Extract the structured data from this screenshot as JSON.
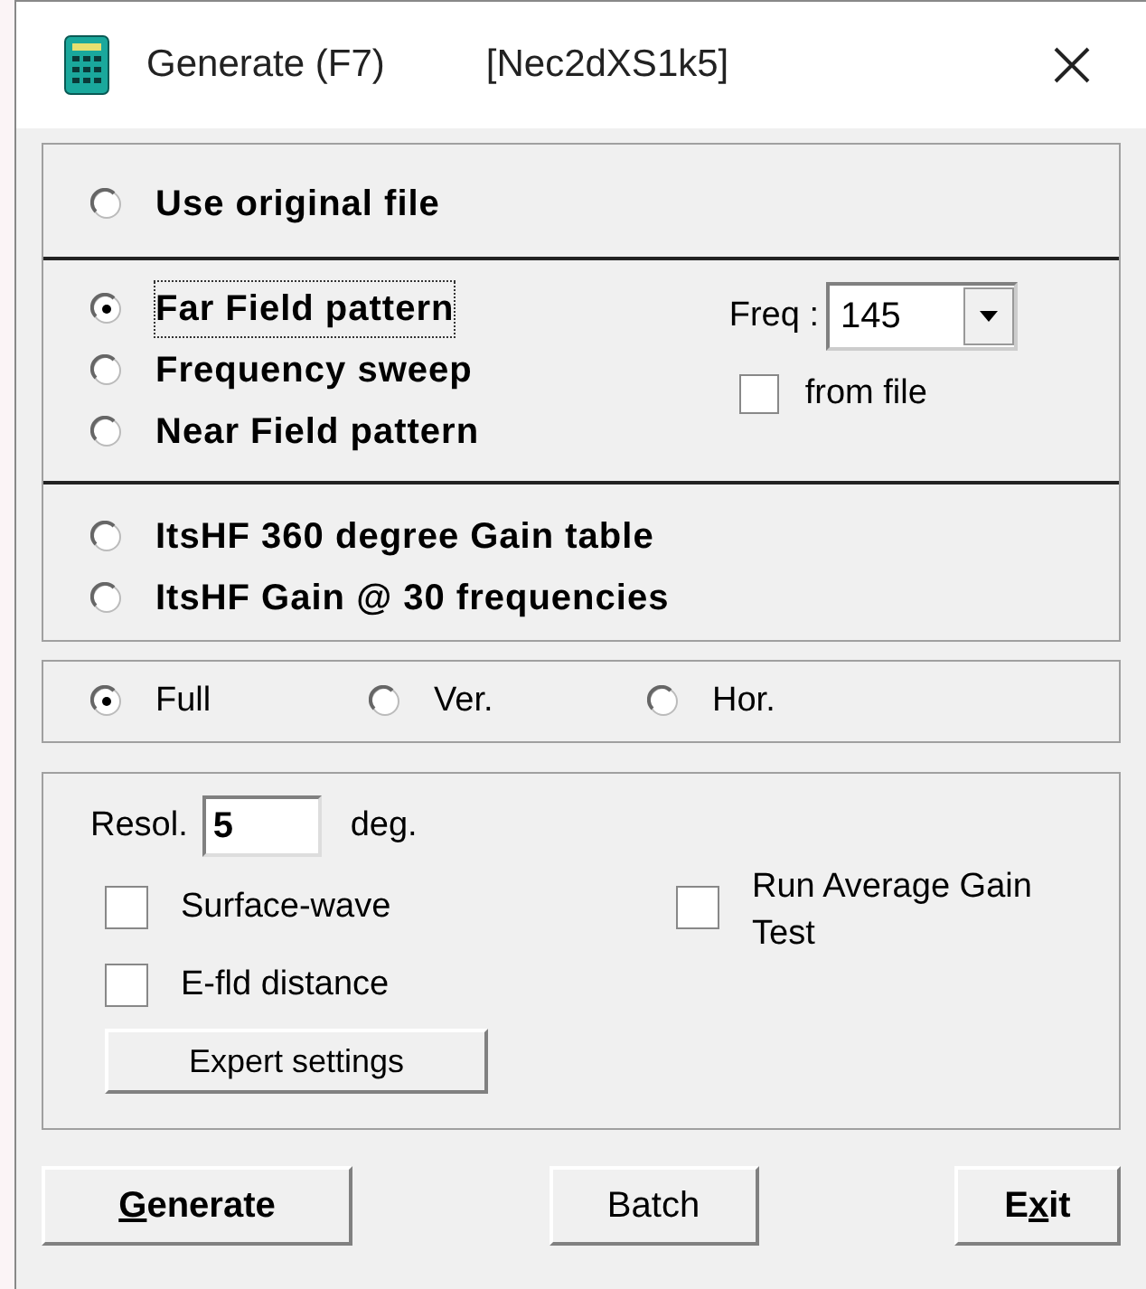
{
  "window": {
    "title": "Generate (F7)",
    "subtitle": "[Nec2dXS1k5]"
  },
  "source_groups": [
    {
      "options": [
        {
          "label": "Use original file",
          "selected": false,
          "focused": false
        }
      ]
    },
    {
      "options": [
        {
          "label": "Far Field pattern",
          "selected": true,
          "focused": true
        },
        {
          "label": "Frequency sweep",
          "selected": false,
          "focused": false
        },
        {
          "label": "Near Field pattern",
          "selected": false,
          "focused": false
        }
      ]
    },
    {
      "options": [
        {
          "label": "ItsHF 360 degree Gain table",
          "selected": false,
          "focused": false
        },
        {
          "label": "ItsHF Gain @ 30 frequencies",
          "selected": false,
          "focused": false
        }
      ]
    }
  ],
  "freq": {
    "label": "Freq :",
    "value": "145",
    "from_file": {
      "label": "from file",
      "checked": false
    }
  },
  "pattern": [
    {
      "label": "Full",
      "selected": true
    },
    {
      "label": "Ver.",
      "selected": false
    },
    {
      "label": "Hor.",
      "selected": false
    }
  ],
  "resolution": {
    "label": "Resol.",
    "value": "5",
    "unit": "deg."
  },
  "options": [
    {
      "label": "Surface-wave",
      "checked": false
    },
    {
      "label": "E-fld distance",
      "checked": false
    }
  ],
  "average_test": {
    "label": "Run Average Gain Test",
    "checked": false
  },
  "expert_button": "Expert settings",
  "buttons": [
    {
      "label": [
        {
          "text": "G",
          "underlined": true
        },
        {
          "text": "enerate",
          "underlined": false
        }
      ],
      "bold": true
    },
    {
      "label": [
        {
          "text": "Batch",
          "underlined": false
        }
      ],
      "bold": false
    },
    {
      "label": [
        {
          "text": "E",
          "underlined": false
        },
        {
          "text": "x",
          "underlined": true
        },
        {
          "text": "it",
          "underlined": false
        }
      ],
      "bold": true
    }
  ]
}
